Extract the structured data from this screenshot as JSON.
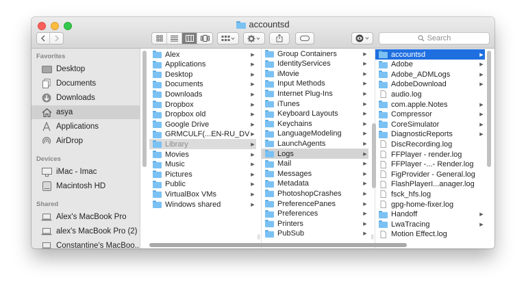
{
  "window": {
    "title": "accountsd"
  },
  "toolbar": {
    "search_placeholder": "Search",
    "back_icon": "chevron-left-icon",
    "forward_icon": "chevron-right-icon"
  },
  "sidebar": {
    "sections": [
      {
        "heading": "Favorites",
        "items": [
          {
            "label": "Desktop",
            "icon": "desktop-icon"
          },
          {
            "label": "Documents",
            "icon": "documents-icon"
          },
          {
            "label": "Downloads",
            "icon": "downloads-icon"
          },
          {
            "label": "asya",
            "icon": "home-icon",
            "selected": true
          },
          {
            "label": "Applications",
            "icon": "applications-icon"
          },
          {
            "label": "AirDrop",
            "icon": "airdrop-icon"
          }
        ]
      },
      {
        "heading": "Devices",
        "items": [
          {
            "label": "iMac - Imac",
            "icon": "imac-icon"
          },
          {
            "label": "Macintosh HD",
            "icon": "hard-drive-icon"
          }
        ]
      },
      {
        "heading": "Shared",
        "items": [
          {
            "label": "Alex's MacBook Pro",
            "icon": "laptop-icon"
          },
          {
            "label": "alex's MacBook Pro (2)",
            "icon": "laptop-icon"
          },
          {
            "label": "Constantine's MacBoo...",
            "icon": "laptop-icon"
          }
        ]
      }
    ]
  },
  "columns": [
    {
      "name": "home",
      "items": [
        {
          "label": "Alex",
          "type": "folder",
          "arrow": true
        },
        {
          "label": "Applications",
          "type": "folder",
          "arrow": true
        },
        {
          "label": "Desktop",
          "type": "folder",
          "arrow": true
        },
        {
          "label": "Documents",
          "type": "folder",
          "arrow": true
        },
        {
          "label": "Downloads",
          "type": "folder",
          "arrow": true
        },
        {
          "label": "Dropbox",
          "type": "folder",
          "arrow": true
        },
        {
          "label": "Dropbox old",
          "type": "folder",
          "arrow": true
        },
        {
          "label": "Google Drive",
          "type": "folder",
          "arrow": true
        },
        {
          "label": "GRMCULF(...EN-RU_DVD",
          "type": "folder",
          "arrow": true
        },
        {
          "label": "Library",
          "type": "folder",
          "arrow": true,
          "state": "grey"
        },
        {
          "label": "Movies",
          "type": "folder",
          "arrow": true
        },
        {
          "label": "Music",
          "type": "folder",
          "arrow": true
        },
        {
          "label": "Pictures",
          "type": "folder",
          "arrow": true
        },
        {
          "label": "Public",
          "type": "folder",
          "arrow": true
        },
        {
          "label": "VirtualBox VMs",
          "type": "folder",
          "arrow": true
        },
        {
          "label": "Windows shared",
          "type": "folder",
          "arrow": true
        }
      ]
    },
    {
      "name": "library",
      "items": [
        {
          "label": "Group Containers",
          "type": "folder",
          "arrow": true
        },
        {
          "label": "IdentityServices",
          "type": "folder",
          "arrow": true
        },
        {
          "label": "iMovie",
          "type": "folder",
          "arrow": true
        },
        {
          "label": "Input Methods",
          "type": "folder",
          "arrow": true
        },
        {
          "label": "Internet Plug-Ins",
          "type": "folder",
          "arrow": true
        },
        {
          "label": "iTunes",
          "type": "folder",
          "arrow": true
        },
        {
          "label": "Keyboard Layouts",
          "type": "folder",
          "arrow": true
        },
        {
          "label": "Keychains",
          "type": "folder",
          "arrow": true
        },
        {
          "label": "LanguageModeling",
          "type": "folder",
          "arrow": true
        },
        {
          "label": "LaunchAgents",
          "type": "folder",
          "arrow": true
        },
        {
          "label": "Logs",
          "type": "folder",
          "arrow": true,
          "state": "greysel"
        },
        {
          "label": "Mail",
          "type": "folder",
          "arrow": true
        },
        {
          "label": "Messages",
          "type": "folder",
          "arrow": true
        },
        {
          "label": "Metadata",
          "type": "folder",
          "arrow": true
        },
        {
          "label": "PhotoshopCrashes",
          "type": "folder",
          "arrow": true
        },
        {
          "label": "PreferencePanes",
          "type": "folder",
          "arrow": true
        },
        {
          "label": "Preferences",
          "type": "folder",
          "arrow": true
        },
        {
          "label": "Printers",
          "type": "folder",
          "arrow": true
        },
        {
          "label": "PubSub",
          "type": "folder",
          "arrow": true
        }
      ]
    },
    {
      "name": "logs",
      "items": [
        {
          "label": "accountsd",
          "type": "folder",
          "arrow": true,
          "state": "blue"
        },
        {
          "label": "Adobe",
          "type": "folder",
          "arrow": true
        },
        {
          "label": "Adobe_ADMLogs",
          "type": "folder",
          "arrow": true
        },
        {
          "label": "AdobeDownload",
          "type": "folder",
          "arrow": true
        },
        {
          "label": "audio.log",
          "type": "file",
          "arrow": false
        },
        {
          "label": "com.apple.Notes",
          "type": "folder",
          "arrow": true
        },
        {
          "label": "Compressor",
          "type": "folder",
          "arrow": true
        },
        {
          "label": "CoreSimulator",
          "type": "folder",
          "arrow": true
        },
        {
          "label": "DiagnosticReports",
          "type": "folder",
          "arrow": true
        },
        {
          "label": "DiscRecording.log",
          "type": "file",
          "arrow": false
        },
        {
          "label": "FFPlayer - render.log",
          "type": "file",
          "arrow": false
        },
        {
          "label": "FFPlayer -...- Render.log",
          "type": "file",
          "arrow": false
        },
        {
          "label": "FigProvider - General.log",
          "type": "file",
          "arrow": false
        },
        {
          "label": "FlashPlayerI...anager.log",
          "type": "file",
          "arrow": false
        },
        {
          "label": "fsck_hfs.log",
          "type": "file",
          "arrow": false
        },
        {
          "label": "gpg-home-fixer.log",
          "type": "file",
          "arrow": false
        },
        {
          "label": "Handoff",
          "type": "folder",
          "arrow": true
        },
        {
          "label": "LwaTracing",
          "type": "folder",
          "arrow": true
        },
        {
          "label": "Motion Effect.log",
          "type": "file",
          "arrow": false
        }
      ]
    }
  ]
}
